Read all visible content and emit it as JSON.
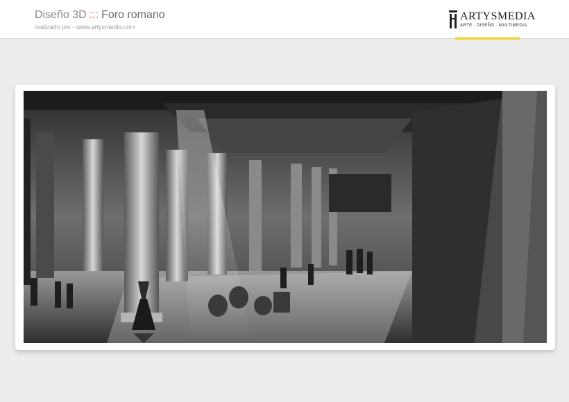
{
  "header": {
    "category": "Diseño 3D",
    "separator": ":::",
    "project": "Foro romano",
    "credit": "realizado por - www.artysmedia.com"
  },
  "logo": {
    "name": "ARTYSMEDIA",
    "tagline": "ARTE · DISEÑO · MULTIMEDIA",
    "accent": "#f3cf1b"
  },
  "colors": {
    "separator": "#e8762b",
    "background": "#ececec"
  }
}
